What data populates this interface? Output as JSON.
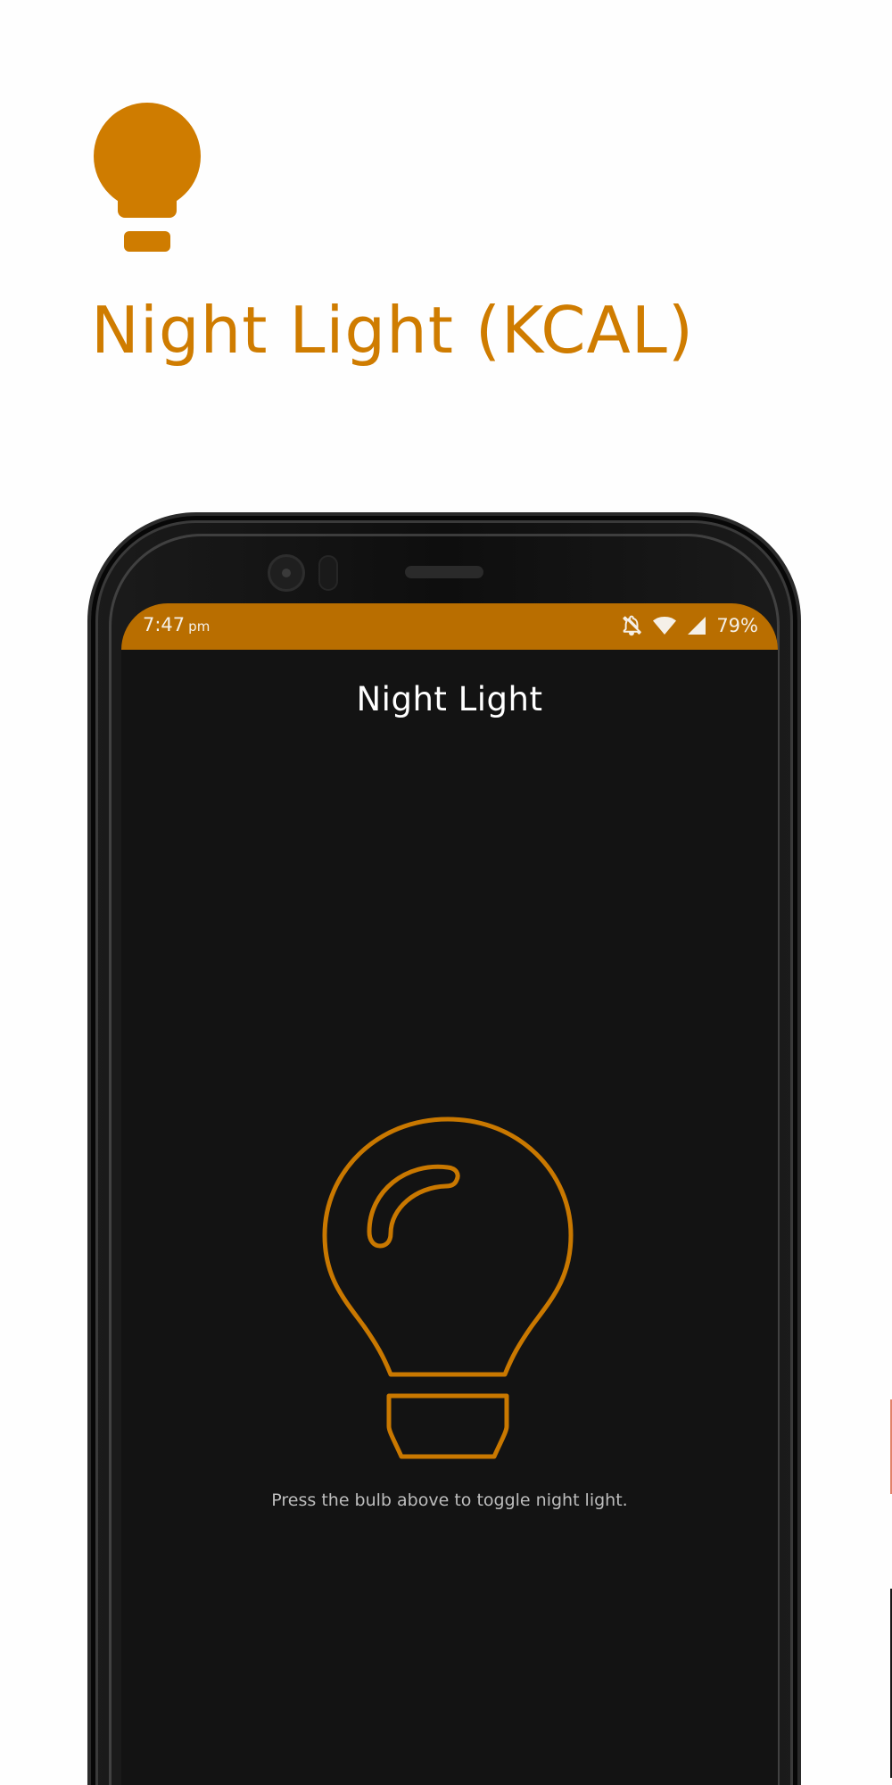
{
  "promo": {
    "title": "Night Light (KCAL)",
    "icon": "lightbulb-filled-icon"
  },
  "status_bar": {
    "time": "7:47",
    "ampm": "pm",
    "battery": "79%",
    "icons": [
      "notifications-off-icon",
      "wifi-icon",
      "cell-signal-icon"
    ]
  },
  "app": {
    "title": "Night Light",
    "bulb_icon": "lightbulb-outline-icon",
    "hint": "Press the bulb above to toggle night light."
  },
  "colors": {
    "accent": "#cf7c00",
    "status_bar": "#b96e00",
    "screen_background": "#131313",
    "bulb_stroke": "#c97800"
  }
}
